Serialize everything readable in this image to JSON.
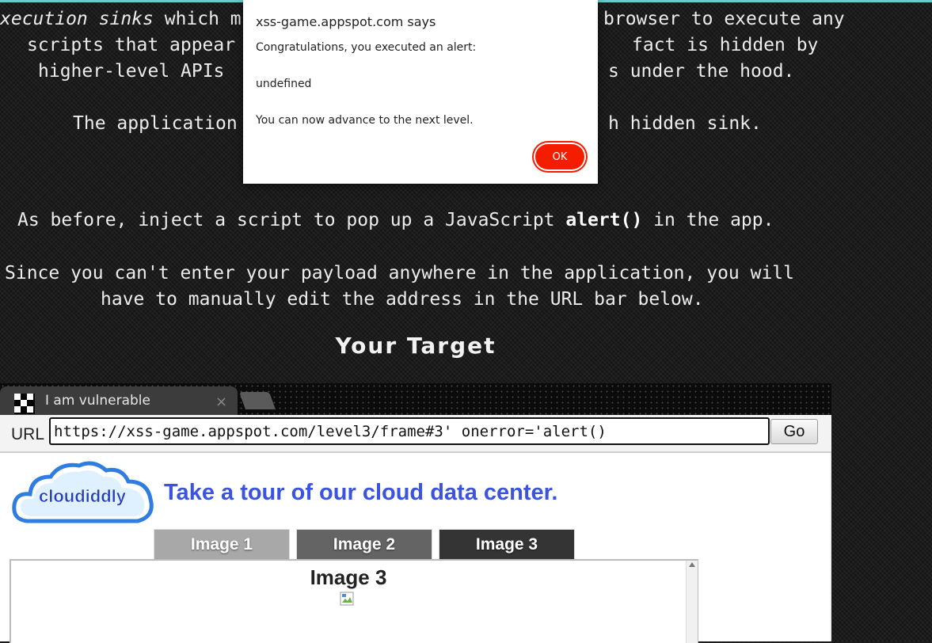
{
  "intro": {
    "line1_em": "xecution sinks",
    "line1_a": " which m",
    "line1_b": "browser to execute any",
    "line2_a": "scripts that appear",
    "line2_b": "fact is hidden by",
    "line3_a": "higher-level APIs",
    "line3_b": "s under the hood.",
    "line4_a": "The application",
    "line4_b": "h hidden sink.",
    "task_pre": "As before, inject a script to pop up a JavaScript ",
    "task_code": "alert()",
    "task_post": " in the app.",
    "note1": "Since you can't enter your payload anywhere in the application, you will",
    "note2": "have to manually edit the address in the URL bar below.",
    "heading": "Your Target"
  },
  "browser": {
    "tab_title": "I am vulnerable",
    "tab_close": "×",
    "url_label": "URL",
    "url_value": "https://xss-game.appspot.com/level3/frame#3' onerror='alert()",
    "go_label": "Go"
  },
  "app": {
    "logo_text": "cloudiddly",
    "tagline": "Take a tour of our cloud data center.",
    "tabs": [
      "Image 1",
      "Image 2",
      "Image 3"
    ],
    "viewer_title": "Image 3"
  },
  "dialog": {
    "title": "xss-game.appspot.com says",
    "line1": "Congratulations, you executed an alert:",
    "line2": "undefined",
    "line3": "You can now advance to the next level.",
    "ok_label": "OK"
  },
  "colors": {
    "accent_line": "#6cc9c9",
    "tagline": "#3a53e0",
    "ok_button": "#f41d00",
    "logo_blue": "#2f7de0"
  }
}
